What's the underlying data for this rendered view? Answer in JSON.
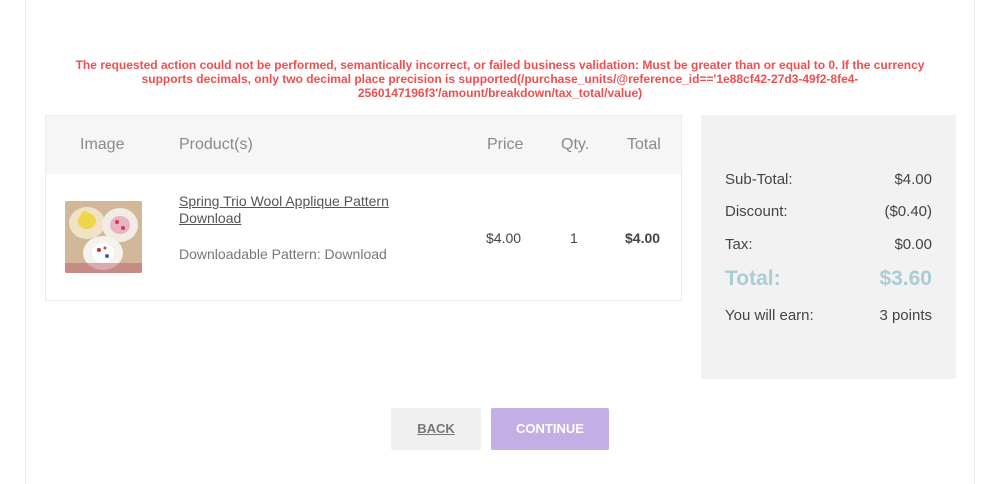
{
  "error_message": "The requested action could not be performed, semantically incorrect, or failed business validation: Must be greater than or equal to 0. If the currency supports decimals, only two decimal place precision is supported(/purchase_units/@reference_id=='1e88cf42-27d3-49f2-8fe4-2560147196f3'/amount/breakdown/tax_total/value)",
  "cart": {
    "headers": {
      "image": "Image",
      "products": "Product(s)",
      "price": "Price",
      "qty": "Qty.",
      "total": "Total"
    },
    "item": {
      "name": "Spring Trio Wool Applique Pattern Download",
      "variant": "Downloadable Pattern: Download",
      "price": "$4.00",
      "qty": "1",
      "total": "$4.00"
    }
  },
  "summary": {
    "subtotal_label": "Sub-Total:",
    "subtotal_value": "$4.00",
    "discount_label": "Discount:",
    "discount_value": "($0.40)",
    "tax_label": "Tax:",
    "tax_value": "$0.00",
    "total_label": "Total:",
    "total_value": "$3.60",
    "earn_label": "You will earn:",
    "earn_value": "3 points"
  },
  "buttons": {
    "back": "BACK",
    "continue": "CONTINUE"
  },
  "colors": {
    "error": "#f04e4e",
    "total_accent": "#a9cdd5",
    "continue_button": "#c3aee6"
  }
}
